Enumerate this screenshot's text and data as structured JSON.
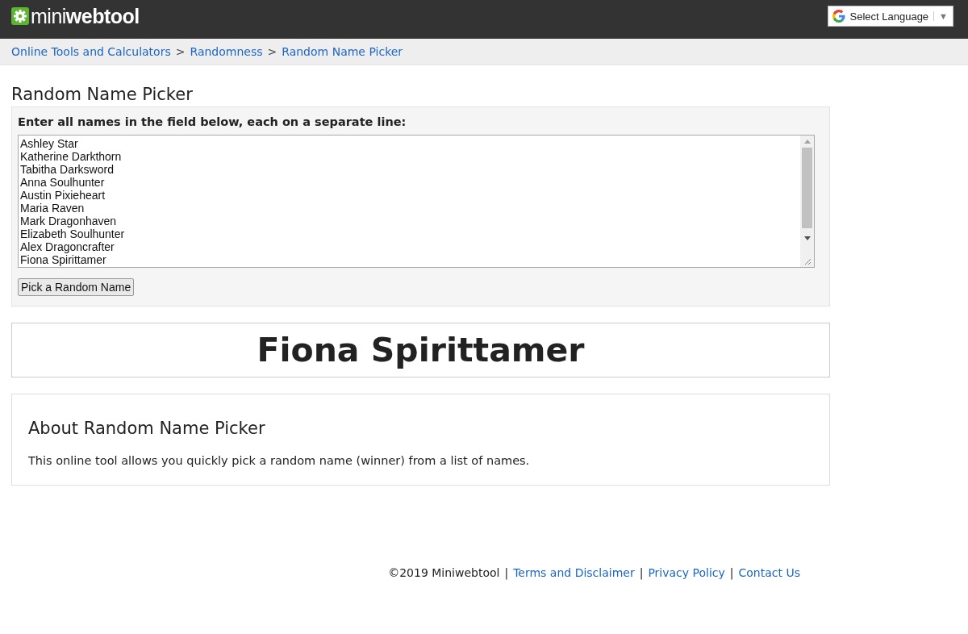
{
  "header": {
    "logo": "mini**webtool**",
    "language_select": {
      "label": "Select Language",
      "arrow": "▼"
    }
  },
  "breadcrumb": {
    "items": [
      "Online Tools and Calculators",
      "Randomness",
      "Random Name Picker"
    ],
    "separator": ">"
  },
  "page_title": "Random Name Picker",
  "form": {
    "label": "Enter all names in the field below, each on a separate line:",
    "names": [
      "Ashley Star",
      "Katherine Darkthorn",
      "Tabitha Darksword",
      "Anna Soulhunter",
      "Austin Pixieheart",
      "Maria Raven",
      "Mark Dragonhaven",
      "Elizabeth Soulhunter",
      "Alex Dragoncrafter",
      "Fiona Spirittamer"
    ],
    "button": "Pick a Random Name"
  },
  "result": "Fiona Spirittamer",
  "about": {
    "title": "About Random Name Picker",
    "text": "This online tool allows you quickly pick a random name (winner) from a list of names."
  },
  "footer": {
    "copyright": "©2019 Miniwebtool",
    "links": [
      "Terms and Disclaimer",
      "Privacy Policy",
      "Contact Us"
    ],
    "separator": "|"
  }
}
